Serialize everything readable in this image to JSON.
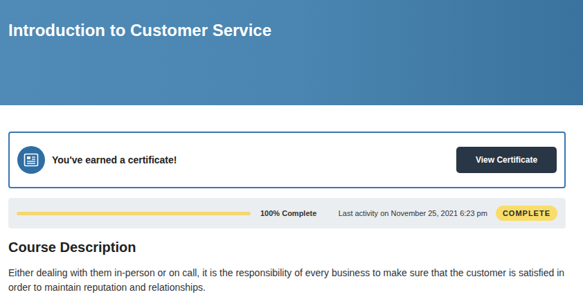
{
  "header": {
    "title": "Introduction to Customer Service"
  },
  "certificate": {
    "message": "You've earned a certificate!",
    "button": "View Certificate"
  },
  "progress": {
    "level": 1,
    "label": "100% Complete",
    "last_activity": "Last activity on November 25, 2021 6:23 pm",
    "status": "COMPLETE"
  },
  "course_description": {
    "heading": "Course Description",
    "text": "Either dealing with them in-person or on call, it is the responsibility of every business to make sure that the customer is satisfied in order to maintain reputation and relationships."
  }
}
